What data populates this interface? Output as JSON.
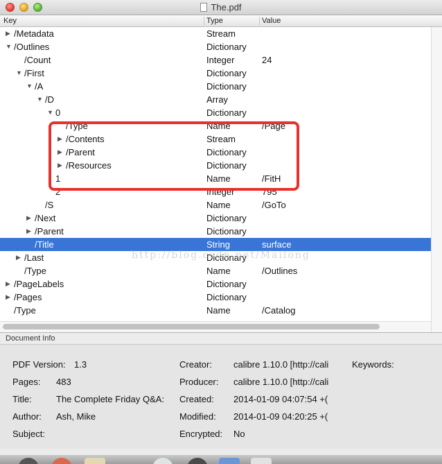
{
  "window": {
    "title": "The.pdf"
  },
  "columns": {
    "key": "Key",
    "type": "Type",
    "value": "Value"
  },
  "rows": [
    {
      "key": "/Metadata",
      "type": "Stream",
      "value": "",
      "indent": 0,
      "expander": "collapsed"
    },
    {
      "key": "/Outlines",
      "type": "Dictionary",
      "value": "",
      "indent": 0,
      "expander": "expanded"
    },
    {
      "key": "/Count",
      "type": "Integer",
      "value": "24",
      "indent": 1,
      "expander": "none"
    },
    {
      "key": "/First",
      "type": "Dictionary",
      "value": "",
      "indent": 1,
      "expander": "expanded"
    },
    {
      "key": "/A",
      "type": "Dictionary",
      "value": "",
      "indent": 2,
      "expander": "expanded"
    },
    {
      "key": "/D",
      "type": "Array",
      "value": "",
      "indent": 3,
      "expander": "expanded"
    },
    {
      "key": "0",
      "type": "Dictionary",
      "value": "",
      "indent": 4,
      "expander": "expanded"
    },
    {
      "key": "/Type",
      "type": "Name",
      "value": "/Page",
      "indent": 5,
      "expander": "none"
    },
    {
      "key": "/Contents",
      "type": "Stream",
      "value": "",
      "indent": 5,
      "expander": "collapsed"
    },
    {
      "key": "/Parent",
      "type": "Dictionary",
      "value": "",
      "indent": 5,
      "expander": "collapsed"
    },
    {
      "key": "/Resources",
      "type": "Dictionary",
      "value": "",
      "indent": 5,
      "expander": "collapsed"
    },
    {
      "key": "1",
      "type": "Name",
      "value": "/FitH",
      "indent": 4,
      "expander": "none"
    },
    {
      "key": "2",
      "type": "Integer",
      "value": "795",
      "indent": 4,
      "expander": "none"
    },
    {
      "key": "/S",
      "type": "Name",
      "value": "/GoTo",
      "indent": 3,
      "expander": "none"
    },
    {
      "key": "/Next",
      "type": "Dictionary",
      "value": "",
      "indent": 2,
      "expander": "collapsed"
    },
    {
      "key": "/Parent",
      "type": "Dictionary",
      "value": "",
      "indent": 2,
      "expander": "collapsed"
    },
    {
      "key": "/Title",
      "type": "String",
      "value": "surface",
      "indent": 2,
      "expander": "none",
      "selected": true
    },
    {
      "key": "/Last",
      "type": "Dictionary",
      "value": "",
      "indent": 1,
      "expander": "collapsed"
    },
    {
      "key": "/Type",
      "type": "Name",
      "value": "/Outlines",
      "indent": 1,
      "expander": "none"
    },
    {
      "key": "/PageLabels",
      "type": "Dictionary",
      "value": "",
      "indent": 0,
      "expander": "collapsed"
    },
    {
      "key": "/Pages",
      "type": "Dictionary",
      "value": "",
      "indent": 0,
      "expander": "collapsed"
    },
    {
      "key": "/Type",
      "type": "Name",
      "value": "/Catalog",
      "indent": 0,
      "expander": "none"
    }
  ],
  "watermark": "http://blog.csdn.net/Mailong",
  "doc_info": {
    "title": "Document Info",
    "pdf_version_label": "PDF Version:",
    "pdf_version": "1.3",
    "pages_label": "Pages:",
    "pages": "483",
    "title_label": "Title:",
    "title_value": "The Complete Friday Q&A:",
    "author_label": "Author:",
    "author": "Ash, Mike",
    "subject_label": "Subject:",
    "subject": "",
    "creator_label": "Creator:",
    "creator": "calibre 1.10.0 [http://cali",
    "producer_label": "Producer:",
    "producer": "calibre 1.10.0 [http://cali",
    "created_label": "Created:",
    "created": "2014-01-09 04:07:54 +(",
    "modified_label": "Modified:",
    "modified": "2014-01-09 04:20:25 +(",
    "encrypted_label": "Encrypted:",
    "encrypted": "No",
    "keywords_label": "Keywords:",
    "keywords": ""
  },
  "icons": {
    "collapsed": "▶",
    "expanded": "▼"
  },
  "colors": {
    "selection": "#3875d7",
    "highlight_box": "#e8312b"
  }
}
